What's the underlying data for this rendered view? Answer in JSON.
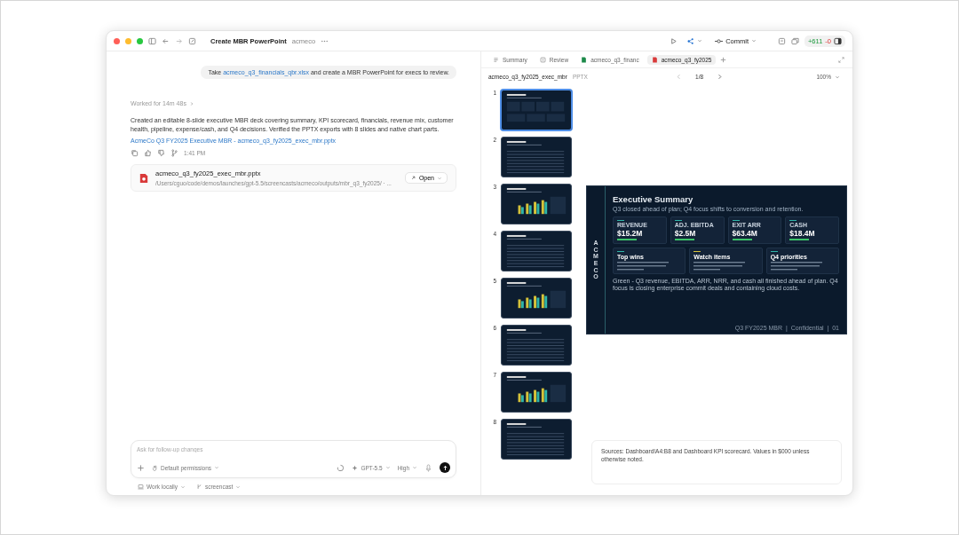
{
  "window": {
    "title": "Create MBR PowerPoint",
    "project": "acmeco",
    "commit_button": "Commit",
    "diff_added": "+611",
    "diff_removed": "-0"
  },
  "chat": {
    "user_message": {
      "before": "Take",
      "link": "acmeco_q3_financials_qbr.xlsx",
      "after": "and create a MBR PowerPoint for execs to review."
    },
    "worked": "Worked for 14m 48s",
    "reply": "Created an editable 8-slide executive MBR deck covering summary, KPI scorecard, financials, revenue mix, customer health, pipeline, expense/cash, and Q4 decisions. Verified the PPTX exports with 8 slides and native chart parts.",
    "reply_link": "AcmeCo Q3 FY2025 Executive MBR - acmeco_q3_fy2025_exec_mbr.pptx",
    "time": "1:41 PM",
    "file": {
      "name": "acmeco_q3_fy2025_exec_mbr.pptx",
      "path": "/Users/cguo/code/demos/launches/gpt-5.5/screencasts/acmeco/outputs/mbr_q3_fy2025/ · ...",
      "open_button": "Open"
    }
  },
  "composer": {
    "placeholder": "Ask for follow-up changes",
    "permissions": "Default permissions",
    "model": "GPT-5.5",
    "effort": "High",
    "location": "Work locally",
    "branch": "screencast"
  },
  "tabs": [
    {
      "kind": "summary",
      "label": "Summary",
      "selected": false
    },
    {
      "kind": "review",
      "label": "Review",
      "selected": false
    },
    {
      "kind": "xlsx",
      "label": "acmeco_q3_financ",
      "selected": false
    },
    {
      "kind": "pptx",
      "label": "acmeco_q3_fy2025",
      "selected": true
    }
  ],
  "viewer": {
    "file_name": "acmeco_q3_fy2025_exec_mbr",
    "file_type": "PPTX",
    "page": "1/8",
    "zoom": "100%",
    "slides": [
      {
        "number": "1",
        "selected": true
      },
      {
        "number": "2",
        "selected": false
      },
      {
        "number": "3",
        "selected": false
      },
      {
        "number": "4",
        "selected": false
      },
      {
        "number": "5",
        "selected": false
      },
      {
        "number": "6",
        "selected": false
      },
      {
        "number": "7",
        "selected": false
      },
      {
        "number": "8",
        "selected": false
      }
    ],
    "current_slide": {
      "brand": "ACMECO",
      "title": "Executive Summary",
      "subtitle": "Q3 closed ahead of plan; Q4 focus shifts to conversion and retention.",
      "kpis": [
        {
          "label": "REVENUE",
          "value": "$15.2M"
        },
        {
          "label": "ADJ. EBITDA",
          "value": "$2.5M"
        },
        {
          "label": "EXIT ARR",
          "value": "$63.4M"
        },
        {
          "label": "CASH",
          "value": "$18.4M"
        }
      ],
      "cards": [
        {
          "title": "Top wins"
        },
        {
          "title": "Watch items"
        },
        {
          "title": "Q4 priorities"
        }
      ],
      "summary": "Green - Q3 revenue, EBITDA, ARR, NRR, and cash all finished ahead of plan. Q4 focus is closing enterprise commit deals and containing cloud costs.",
      "footer": "Q3 FY2025 MBR  |  Confidential  |  01"
    },
    "notes": "Sources: Dashboard!A4:B8 and Dashboard KPI scorecard. Values in $000 unless otherwise noted."
  }
}
